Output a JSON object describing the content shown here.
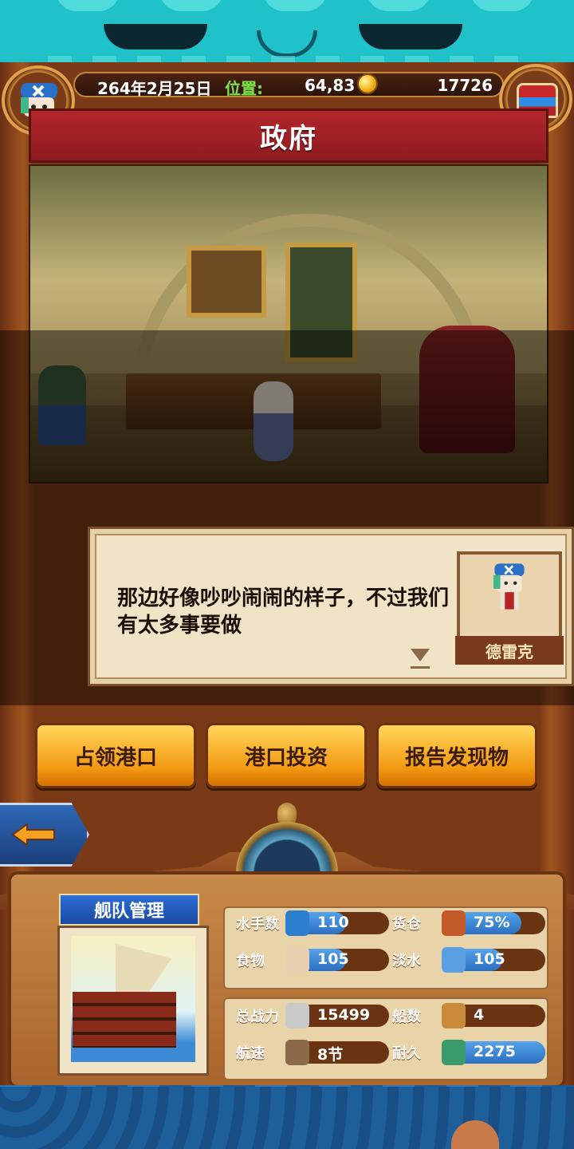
{
  "hud": {
    "date": "264年2月25日",
    "position_label": "位置:",
    "position_value": "64,83",
    "gold": "17726"
  },
  "location_title": "政府",
  "dialog": {
    "text": "那边好像吵吵闹闹的样子，不过我们有太多事要做",
    "speaker": "德雷克"
  },
  "actions": [
    "占领港口",
    "港口投资",
    "报告发现物"
  ],
  "fleet": {
    "title": "舰队管理",
    "stats": [
      {
        "label": "水手数",
        "value": "110",
        "fill": 0.55,
        "icon": "sailor-icon"
      },
      {
        "label": "货仓",
        "value": "75%",
        "fill": 0.75,
        "icon": "cargo-icon"
      },
      {
        "label": "食物",
        "value": "105",
        "fill": 0.55,
        "icon": "food-icon"
      },
      {
        "label": "淡水",
        "value": "105",
        "fill": 0.55,
        "icon": "water-icon"
      },
      {
        "label": "总战力",
        "value": "15499",
        "fill": 0.0,
        "icon": "swords-icon"
      },
      {
        "label": "船数",
        "value": "4",
        "fill": 0.0,
        "icon": "ship-count-icon"
      },
      {
        "label": "航速",
        "value": "8节",
        "fill": 0.0,
        "icon": "speed-icon"
      },
      {
        "label": "耐久",
        "value": "2275",
        "fill": 1.0,
        "icon": "durability-icon"
      }
    ]
  },
  "colors": {
    "accent_gold": "#f39a12",
    "banner_red": "#b2262a",
    "stat_blue": "#2c6fc2",
    "position_green": "#7ee34a"
  }
}
